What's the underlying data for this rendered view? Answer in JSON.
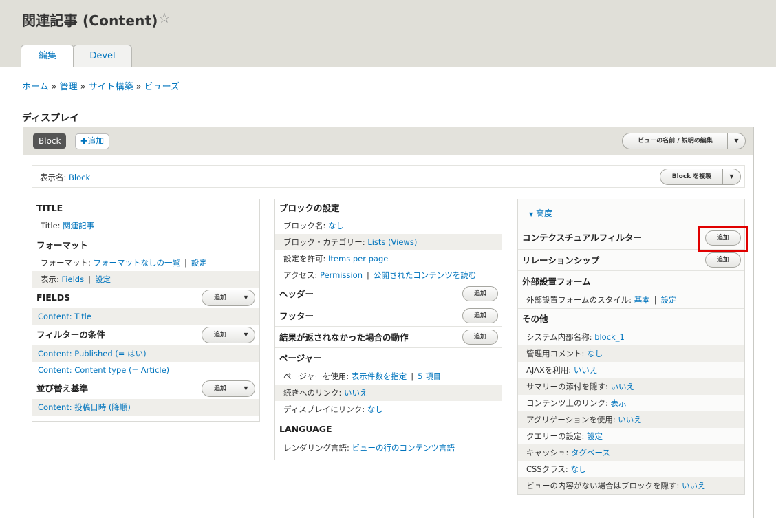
{
  "header": {
    "title": "関連記事 (Content)",
    "star_icon": "☆",
    "tabs": [
      {
        "label": "編集"
      },
      {
        "label": "Devel"
      }
    ]
  },
  "breadcrumb": {
    "items": [
      "ホーム",
      "管理",
      "サイト構築",
      "ビューズ"
    ],
    "separator": "»"
  },
  "display_section": {
    "title": "ディスプレイ",
    "current_display": "Block",
    "add_label": "追加",
    "add_icon": "✚",
    "edit_name_label": "ビューの名前 / 説明の編集",
    "display_name_label": "表示名:",
    "display_name_value": "Block",
    "duplicate_label": "Block を複製"
  },
  "col1": {
    "title_heading": "TITLE",
    "title_label": "Title:",
    "title_value": "関連記事",
    "format_heading": "フォーマット",
    "format_label": "フォーマット:",
    "format_value": "フォーマットなしの一覧",
    "format_settings": "設定",
    "show_label": "表示:",
    "show_value": "Fields",
    "show_settings": "設定",
    "fields_heading": "FIELDS",
    "field_items": [
      "Content: Title"
    ],
    "filters_heading": "フィルターの条件",
    "filter_items": [
      "Content: Published (= はい)",
      "Content: Content type (= Article)"
    ],
    "sort_heading": "並び替え基準",
    "sort_items": [
      "Content: 投稿日時 (降順)"
    ],
    "add_label": "追加"
  },
  "col2": {
    "block_heading": "ブロックの設定",
    "block_name_label": "ブロック名:",
    "block_name_value": "なし",
    "block_cat_label": "ブロック・カテゴリー:",
    "block_cat_value": "Lists (Views)",
    "allow_label": "設定を許可:",
    "allow_value": "Items per page",
    "access_label": "アクセス:",
    "access_value": "Permission",
    "access_value2": "公開されたコンテンツを読む",
    "header_heading": "ヘッダー",
    "footer_heading": "フッター",
    "noresult_heading": "結果が返されなかった場合の動作",
    "pager_heading": "ページャー",
    "pager_label": "ページャーを使用:",
    "pager_value": "表示件数を指定",
    "pager_value2": "5 項目",
    "more_label": "続きへのリンク:",
    "more_value": "いいえ",
    "link_label": "ディスプレイにリンク:",
    "link_value": "なし",
    "lang_heading": "LANGUAGE",
    "lang_label": "レンダリング言語:",
    "lang_value": "ビューの行のコンテンツ言語",
    "add_label": "追加"
  },
  "col3": {
    "advanced_label": "高度",
    "advanced_icon": "▼",
    "contextual_heading": "コンテクスチュアルフィルター",
    "relationship_heading": "リレーションシップ",
    "exposed_heading": "外部設置フォーム",
    "exposed_label": "外部設置フォームのスタイル:",
    "exposed_value": "基本",
    "exposed_settings": "設定",
    "other_heading": "その他",
    "other_rows": [
      {
        "label": "システム内部名称:",
        "value": "block_1"
      },
      {
        "label": "管理用コメント:",
        "value": "なし"
      },
      {
        "label": "AJAXを利用:",
        "value": "いいえ"
      },
      {
        "label": "サマリーの添付を隠す:",
        "value": "いいえ"
      },
      {
        "label": "コンテンツ上のリンク:",
        "value": "表示"
      },
      {
        "label": "アグリゲーションを使用:",
        "value": "いいえ"
      },
      {
        "label": "クエリーの設定:",
        "value": "設定"
      },
      {
        "label": "キャッシュ:",
        "value": "タグベース"
      },
      {
        "label": "CSSクラス:",
        "value": "なし"
      },
      {
        "label": "ビューの内容がない場合はブロックを隠す:",
        "value": "いいえ"
      }
    ],
    "add_label": "追加"
  },
  "colors": {
    "link": "#0074bd",
    "highlight": "#e00000"
  }
}
